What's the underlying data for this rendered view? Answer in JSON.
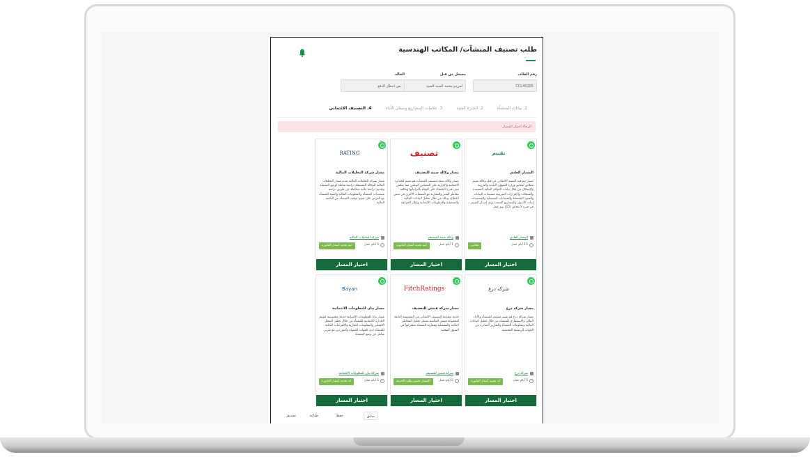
{
  "header": {
    "title": "طلب تصنيف المنشآت/ المكاتب الهندسية"
  },
  "fields": [
    {
      "label": "رقم الطلب",
      "value": "CCL40205"
    },
    {
      "label": "مسجل من قبل",
      "value": "لمرجو محمد السيد السيد"
    },
    {
      "label": "الحالة",
      "value": "نص انتظار الدفع"
    }
  ],
  "steps": [
    "1. بيانات المنشأة",
    "2. الخبرة الفنية",
    "3. علامات المشاريع وسجل الأداء",
    "4. التصنيف الائتماني"
  ],
  "alert": "الرجاء اختيار المسار",
  "cards": [
    {
      "logo": "تقييم",
      "title": "المسار العادي",
      "desc": "مسار يتم فيه التقييم الائتماني من قبل وكالة تقييم مطابق لمعايير وزارة الشؤون البلدية والقروية والإسكان من خلال بيانات القوائم المالية المعتمدة والسجلات والإقرارات الضريبية مستندات البيانات والعقود المسجلة والحسابات التشغيلية والمستندات إثبات الأصول والمشاريع المنفذة ويتم إصدار التقييم في فترة لا تتجاوز (15) يوم عمل",
      "link": "المسار العادي",
      "days": "15 أيام عمل",
      "badge": "مجاني"
    },
    {
      "logo": "تصنيف",
      "title": "مسار وكالة سمة للتصنيف",
      "desc": "مسار وكالة سمة لتصنيف المنشآت هو تقييم للجدارة الائتمانية والإدارية على المقياس الوطني مما يعكس مدى قدرة المنشأة على الوفاء بالتزاماتها وتكلفة مخاطر التعثر والمقارنة مع المنشآت الأخرى في نفس القطاع، وذلك من خلال تحليل البيانات المالية والتشغيلية والمعلومات الائتمانية وإطار الحوكمة",
      "link": "وكالة سمة للتصنيف",
      "days": "1 أيام عمل",
      "badge": "أبيه تحديد أسعار الفاتورة"
    },
    {
      "logo": "RATING",
      "title": "مسار شركة التحليلات المالية",
      "desc": "مسار شركة التحليلات المالية يقدم مسار التحليلات المالية للوكالة المستقلة دراسة شاملة لوضع المنشأة وتقديم دراسة مالية متكاملة عن طريق دراسة مستندات المنشأة والمعلومات المالية والفنية للمنشأة مع العرض على تقييم موقف المنشأة من الناحية المالية",
      "link": "شركة التحليلات المالية",
      "days": "5 أيام عمل",
      "badge": "أبيه تحديد أسعار الفاتورة"
    },
    {
      "logo": "شركة درع",
      "title": "مسار شركة درع",
      "desc": "مسار شركة درع هو تقييم مستمر للمنشأة والأداء المالي والاستثماري للمنشأة من خلال تحليل البيانات المالية ومعلومات المنشأة والتقارير الصادرة من الجهات الرسمية المختصة",
      "link": "شركة درع",
      "days": "5 أيام عمل",
      "badge": "أنه تحديد أسعار الفاتورة"
    },
    {
      "logo": "FitchRatings",
      "title": "مسار شركة فيتش للتصنيف",
      "desc": "خدمة متقدمة للتصنيف الائتماني من المؤسسة التابعة لمجموعة فيتش العالمية تشمل تحليل المخاطر المالية والتشغيلية ومقارنة المنشأة بنظيراتها في السوق المحلية",
      "link": "شركة فيتش للتصنيف",
      "days": "5 أيام عمل",
      "badge": "الأسعار حسب طلب الخدمة"
    },
    {
      "logo": "Bayan",
      "title": "مسار بيان للمعلومات الائتمانية",
      "desc": "مسار بيان للمعلومات الائتمانية خدمة متخصصة لتقييم الجدارة الائتمانية للمنشأة من خلال تحليل السجل الائتماني والمعلومات التجارية والالتزامات المالية للمنشأة لدى الجهات الممولة والموردين مع تقرير شامل عن وضع المنشأة",
      "link": "شركة بيان للمعلومات الائتمانية",
      "days": "5 أيام عمل",
      "badge": "أنه تحديد أسعار الفاتورة"
    }
  ],
  "choose_label": "اختيار المسار",
  "nav": {
    "prev": "سابق",
    "save": "حفظ",
    "print": "طباعة",
    "next": "تصديق"
  }
}
